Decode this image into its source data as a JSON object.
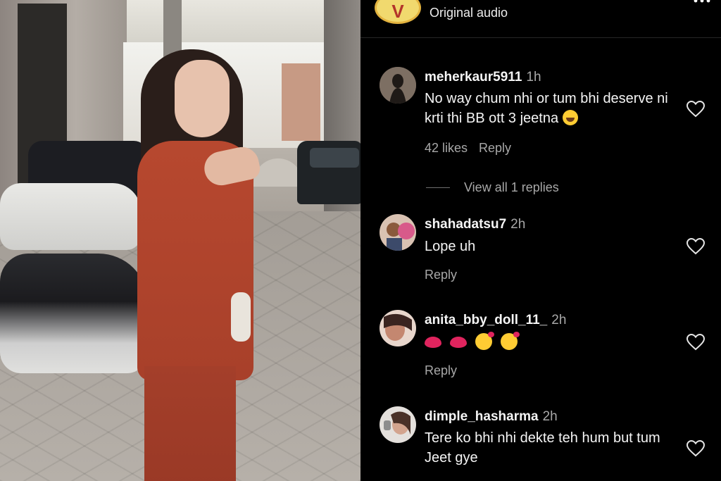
{
  "header": {
    "subtitle": "Original audio"
  },
  "comments": [
    {
      "username": "meherkaur5911",
      "time": "1h",
      "text": "No way chum nhi or tum bhi deserve ni krti thi BB ott 3 jeetna",
      "likes": "42 likes",
      "reply_label": "Reply",
      "view_replies": "View all 1 replies",
      "avatar_color": "#5b5048"
    },
    {
      "username": "shahadatsu7",
      "time": "2h",
      "text": "Lope uh",
      "reply_label": "Reply",
      "avatar_color": "#c9a388"
    },
    {
      "username": "anita_bby_doll_11_",
      "time": "2h",
      "reply_label": "Reply",
      "avatar_color": "#d7a08c",
      "emoji_names": [
        "lips",
        "lips",
        "kissing-face",
        "kissing-face"
      ]
    },
    {
      "username": "dimple_hasharma",
      "time": "2h",
      "text": "Tere ko bhi nhi dekte teh hum but tum Jeet gye",
      "avatar_color": "#b9a7a0"
    }
  ],
  "icons": {
    "like": "heart-outline-icon",
    "more": "more-icon"
  },
  "colors": {
    "background": "#000000",
    "primary_text": "#f5f5f5",
    "secondary_text": "#a8a8a8"
  }
}
